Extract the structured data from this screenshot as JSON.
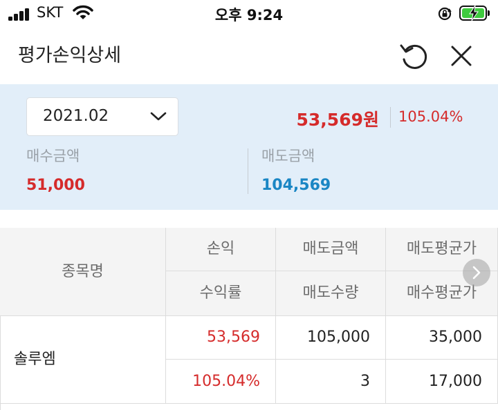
{
  "status_bar": {
    "carrier": "SKT",
    "time": "오후 9:24",
    "icons": [
      "signal-icon",
      "wifi-icon",
      "orientation-lock-icon",
      "battery-charging-icon"
    ]
  },
  "header": {
    "title": "평가손익상세",
    "icons": [
      "refresh-icon",
      "close-icon"
    ]
  },
  "summary": {
    "month": "2021.02",
    "profit_amount": "53,569원",
    "profit_rate": "105.04%",
    "buy_label": "매수금액",
    "buy_value": "51,000",
    "sell_label": "매도금액",
    "sell_value": "104,569"
  },
  "table": {
    "headers": {
      "name": "종목명",
      "profit": "손익",
      "sell_amount": "매도금액",
      "sell_avg_price": "매도평균가",
      "return_rate": "수익률",
      "sell_qty": "매도수량",
      "buy_avg_price": "매수평균가"
    },
    "rows": [
      {
        "name": "솔루엠",
        "profit": "53,569",
        "sell_amount": "105,000",
        "sell_avg_price": "35,000",
        "return_rate": "105.04%",
        "sell_qty": "3",
        "buy_avg_price": "17,000"
      }
    ]
  },
  "colors": {
    "profit": "#d52b2b",
    "sell": "#1a86c4",
    "summary_bg": "#e2eef9",
    "header_cell_bg": "#f4f4f4"
  }
}
